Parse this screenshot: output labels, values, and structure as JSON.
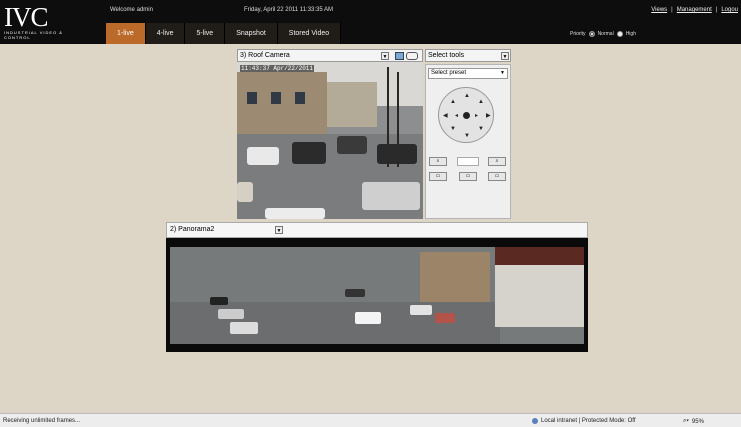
{
  "header": {
    "logo_big": "IVC",
    "logo_small": "INDUSTRIAL VIDEO & CONTROL",
    "welcome": "Welcome admin",
    "datetime": "Friday, April 22 2011 11:33:35 AM",
    "links": [
      "Views",
      "Management",
      "Logou"
    ],
    "tabs": [
      "1-live",
      "4-live",
      "5-live",
      "Snapshot",
      "Stored Video"
    ],
    "active_tab": "1-live",
    "priority": {
      "label": "Priority",
      "normal": "Normal",
      "high": "High"
    }
  },
  "camera1": {
    "selected": "3) Roof Camera",
    "timestamp": "11:43:37 Apr/22/2011"
  },
  "ptz": {
    "tools_selected": "Select tools",
    "preset_selected": "Select preset"
  },
  "camera2": {
    "selected": "2) Panorama2"
  },
  "statusbar": {
    "left": "Receiving unlimited frames...",
    "zone": "Local intranet | Protected Mode: Off",
    "zoom": "95%"
  },
  "colors": {
    "active_tab": "#bb6a2a",
    "topbar": "#0d0d0d",
    "background": "#ddd5c6"
  }
}
